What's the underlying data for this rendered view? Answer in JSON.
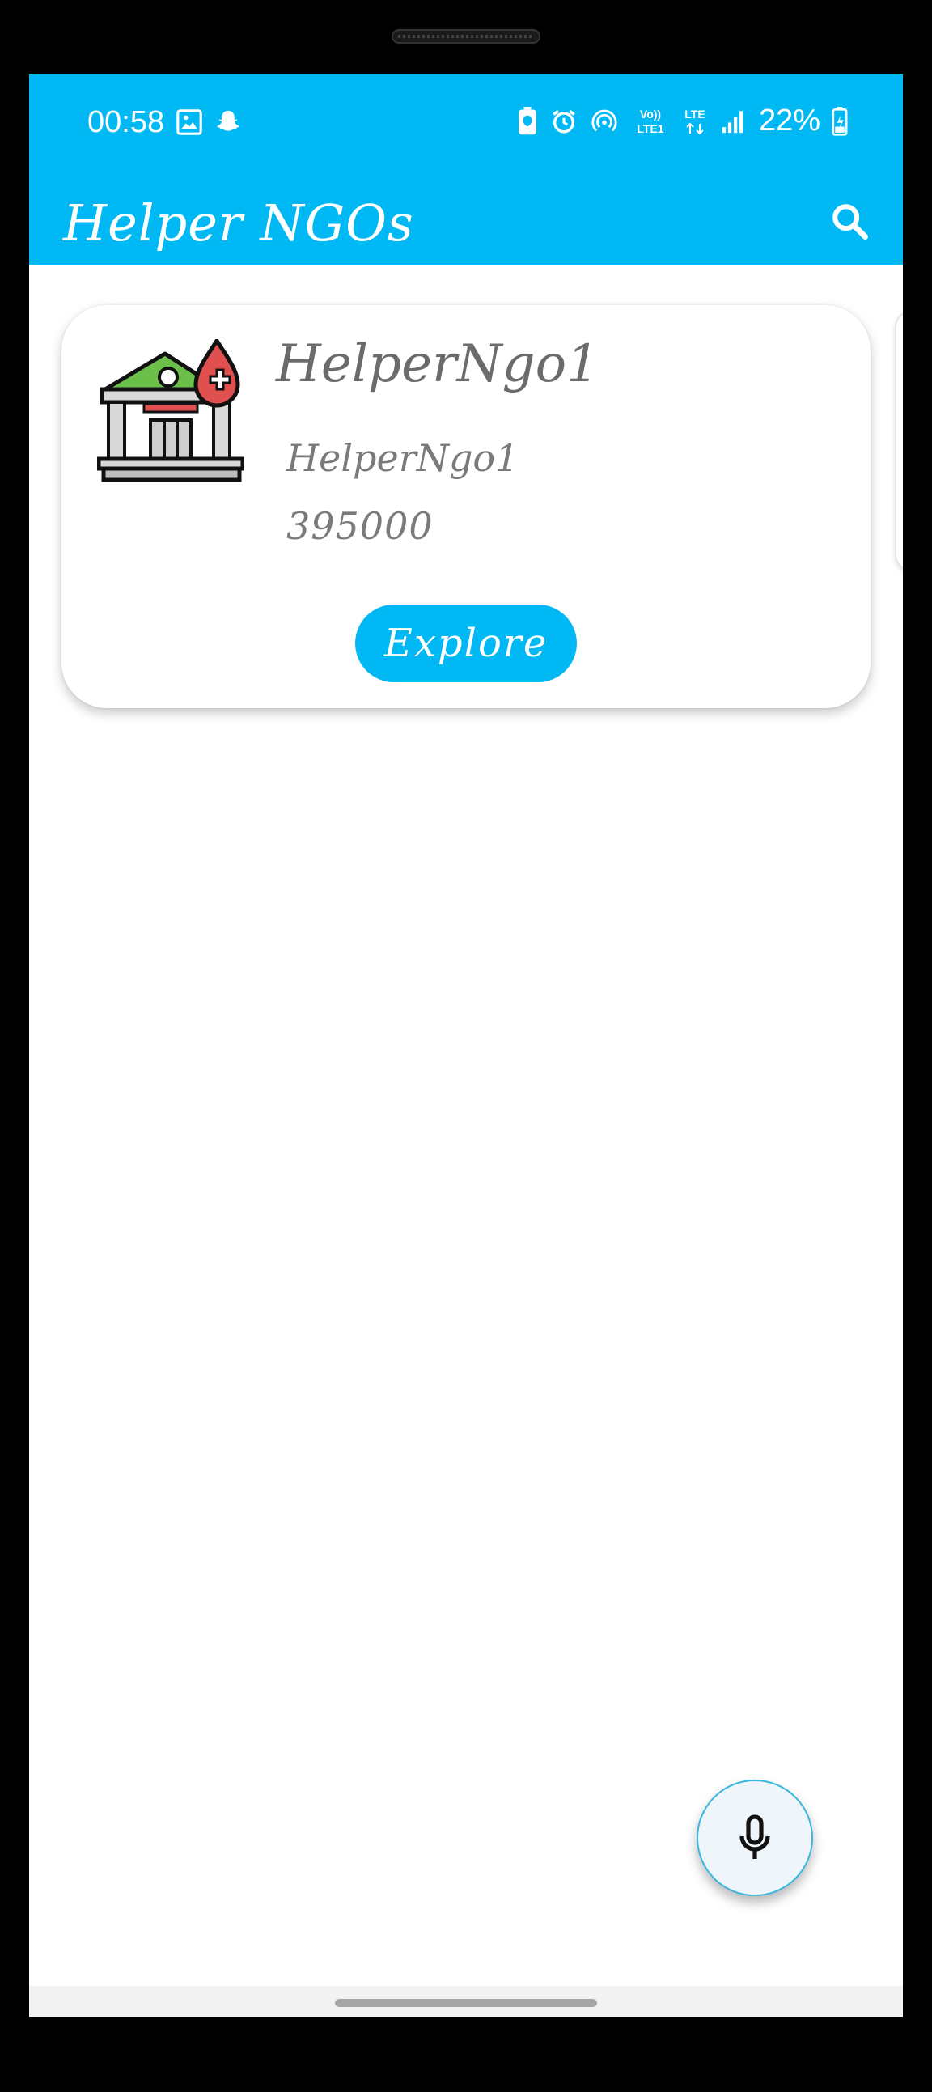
{
  "status_bar": {
    "time": "00:58",
    "battery_percent": "22%",
    "left_icons": [
      "gallery-icon",
      "snapchat-icon"
    ],
    "right_icons": [
      "battery-saver-icon",
      "alarm-icon",
      "hotspot-icon",
      "volte-icon",
      "lte-icon",
      "signal-icon",
      "battery-charging-icon"
    ],
    "volte_label": "Vo)) LTE1",
    "lte_label": "LTE"
  },
  "app_bar": {
    "title": "Helper NGOs",
    "search_icon": "search-icon"
  },
  "ngo_list": [
    {
      "name": "HelperNgo1",
      "subtitle": "HelperNgo1",
      "amount": "395000",
      "button_label": "Explore",
      "logo_icon": "ngo-building-blood-icon"
    }
  ],
  "fab": {
    "icon": "microphone-icon"
  },
  "colors": {
    "primary": "#00b9f4",
    "text_gray": "#6b6b6b",
    "fab_bg": "#eef5fb",
    "logo_roof": "#6cc04a",
    "logo_drop": "#e0504f"
  }
}
